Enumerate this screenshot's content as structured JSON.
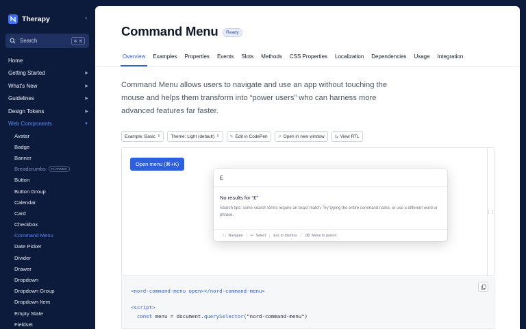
{
  "brand": {
    "name": "Therapy",
    "switch_icon": "chevron-updown-icon"
  },
  "search": {
    "label": "Search",
    "shortcut": "⌘ K"
  },
  "nav": [
    {
      "label": "Home",
      "chevron": false
    },
    {
      "label": "Getting Started",
      "chevron": true
    },
    {
      "label": "What's New",
      "chevron": true
    },
    {
      "label": "Guidelines",
      "chevron": true
    },
    {
      "label": "Design Tokens",
      "chevron": true
    },
    {
      "label": "Web Components",
      "chevron": true
    }
  ],
  "components": [
    "Avatar",
    "Badge",
    "Banner",
    "Breadcrumbs",
    "Button",
    "Button Group",
    "Calendar",
    "Card",
    "Checkbox",
    "Command Menu",
    "Date Picker",
    "Divider",
    "Drawer",
    "Dropdown",
    "Dropdown Group",
    "Dropdown Item",
    "Empty State",
    "Fieldset"
  ],
  "planned_badge": "PLANNED",
  "page": {
    "title": "Command Menu",
    "status": "Ready"
  },
  "tabs": [
    "Overview",
    "Examples",
    "Properties",
    "Events",
    "Slots",
    "Methods",
    "CSS Properties",
    "Localization",
    "Dependencies",
    "Usage",
    "Integration"
  ],
  "lead": "Command Menu allows users to navigate and use an app without touching the mouse and helps them transform into “power users” who can harness more advanced features far faster.",
  "toolbar": {
    "example": "Example: Basic",
    "theme": "Theme: Light (default)",
    "codepen": "Edit in CodePen",
    "new_window": "Open in new window",
    "rtl": "View RTL"
  },
  "preview": {
    "open_button": "Open menu (⌘+K)",
    "query": "£",
    "no_results": "No results for “£”",
    "tips": "Search tips: some search terms require an exact match. Try typing the entire command name, or use a different word or phrase.",
    "hints": [
      {
        "key": "↑↓",
        "label": "Navigate"
      },
      {
        "key": "↵",
        "label": "Select"
      },
      {
        "key": "",
        "label": "Esc to dismiss"
      },
      {
        "key": "⌫",
        "label": "Move to parent"
      }
    ]
  },
  "code": {
    "line1_open": "<nord-command-menu",
    "line1_attr": "open",
    "line1_mid": "></",
    "line1_close": "nord-command-menu",
    "line1_end": ">",
    "line3": "<script>",
    "line4_kw": "const",
    "line4_a": " menu = document.",
    "line4_fn": "querySelector",
    "line4_b": "(\"nord-command-menu\")"
  },
  "colors": {
    "sidebar": "#0c1a3b",
    "accent": "#2e5fdd",
    "active_link": "#5d8bf7"
  }
}
